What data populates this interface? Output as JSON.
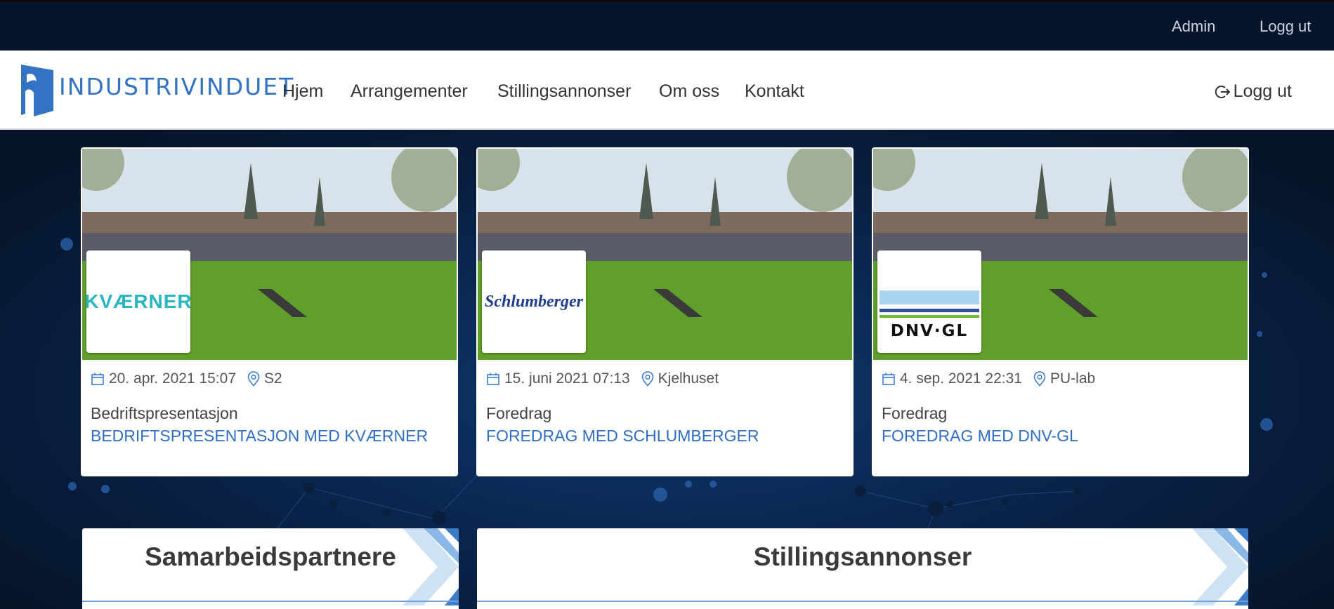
{
  "topbar": {
    "admin_label": "Admin",
    "logout_label": "Logg ut"
  },
  "brand": {
    "name": "INDUSTRIVINDUET"
  },
  "nav": {
    "items": [
      {
        "label": "Hjem"
      },
      {
        "label": "Arrangementer"
      },
      {
        "label": "Stillingsannonser"
      },
      {
        "label": "Om oss"
      },
      {
        "label": "Kontakt"
      }
    ],
    "logout_label": "Logg ut"
  },
  "events": [
    {
      "date": "20. apr. 2021 15:07",
      "location": "S2",
      "type": "Bedriftspresentasjon",
      "title": "BEDRIFTSPRESENTASJON MED KVÆRNER",
      "company_logo": "KVÆRNER"
    },
    {
      "date": "15. juni 2021 07:13",
      "location": "Kjelhuset",
      "type": "Foredrag",
      "title": "FOREDRAG MED SCHLUMBERGER",
      "company_logo": "Schlumberger"
    },
    {
      "date": "4. sep. 2021 22:31",
      "location": "PU-lab",
      "type": "Foredrag",
      "title": "FOREDRAG MED DNV-GL",
      "company_logo": "DNV·GL"
    }
  ],
  "panels": {
    "partners_title": "Samarbeidspartnere",
    "jobs_title": "Stillingsannonser"
  },
  "colors": {
    "accent": "#2f6ec4",
    "topbar_bg": "#06152b",
    "kvaerner": "#2bb5c0",
    "schlumberger": "#1f3d8f",
    "dnv_light": "#a9d3ee",
    "dnv_dark": "#2f4f9c"
  },
  "icons": {
    "calendar": "calendar-icon",
    "location": "map-pin-icon",
    "logout": "logout-icon"
  }
}
